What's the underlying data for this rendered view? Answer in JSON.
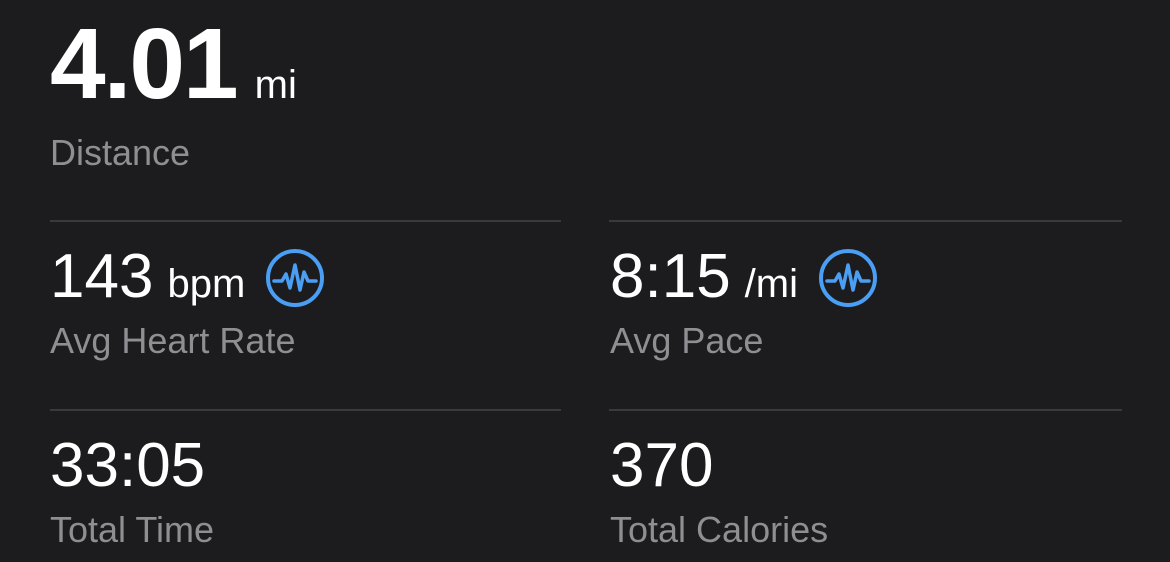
{
  "distance": {
    "value": "4.01",
    "unit": "mi",
    "label": "Distance"
  },
  "heart_rate": {
    "value": "143",
    "unit": "bpm",
    "label": "Avg Heart Rate",
    "icon": "heart-rate-chart-icon"
  },
  "pace": {
    "value": "8:15",
    "unit": "/mi",
    "label": "Avg Pace",
    "icon": "pace-chart-icon"
  },
  "time": {
    "value": "33:05",
    "label": "Total Time"
  },
  "calories": {
    "value": "370",
    "label": "Total Calories"
  },
  "colors": {
    "background": "#1c1c1e",
    "text": "#ffffff",
    "label": "#8e8e93",
    "divider": "#3a3a3c",
    "accent": "#4a9ff5"
  }
}
